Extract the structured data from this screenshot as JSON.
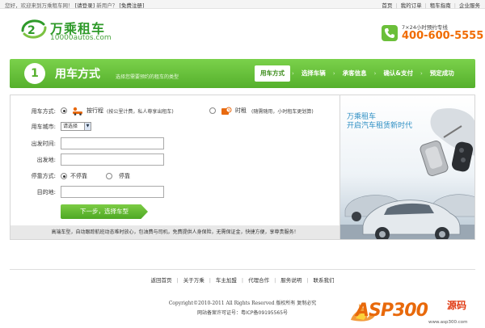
{
  "topbar": {
    "welcome": "您好，欢迎来到万乘租车网！",
    "login": "[请登录]",
    "new_user": "新用户？",
    "register": "[免费注册]",
    "links": [
      "首页",
      "我的订单",
      "租车指南",
      "企业服务"
    ]
  },
  "header": {
    "logo_cn": "万乘租车",
    "logo_en": "10000autos.com",
    "hotline_label": "7×24小时预约专线",
    "hotline_number": "400-600-5555"
  },
  "stepbar": {
    "number": "1",
    "title": "用车方式",
    "subtitle": "选择您需要预约的租车的类型",
    "steps": [
      "用车方式",
      "选择车辆",
      "承客信息",
      "确认&支付",
      "预定成功"
    ],
    "active_index": 0
  },
  "form": {
    "mode_label": "用车方式:",
    "mode_options": [
      {
        "label": "按行程",
        "hint": "(按公里计费，私人尊享出租车)",
        "selected": true
      },
      {
        "label": "时租",
        "hint": "(随需随用，小时租车更划算)",
        "selected": false
      }
    ],
    "city_label": "用车城市:",
    "city_value": "请选择",
    "depart_time_label": "出发时间:",
    "depart_place_label": "出发地:",
    "stop_label": "停靠方式:",
    "stop_options": [
      {
        "label": "不停靠",
        "selected": true
      },
      {
        "label": "停靠",
        "selected": false
      }
    ],
    "destination_label": "目的地:",
    "next_button": "下一步，选择车型",
    "notice": "高端车型，自动跟踪航班动态难时放心，包油费与司机，免费提供人身保险，无需保证金，快捷方便，享尊贵服务！"
  },
  "ad": {
    "brand": "万乘租车",
    "slogan": "开启汽车租赁新时代"
  },
  "footer": {
    "links": [
      "返回首页",
      "关于万乘",
      "车主加盟",
      "代理合作",
      "服务说明",
      "联系我们"
    ],
    "copyright": "Copyright©2010-2011 All Rights Reserved 版权所有 复制必究",
    "icp": "网站备案许可证号：粤ICP备09195565号"
  },
  "watermark": {
    "brand": "ASP300",
    "brand_cn": "源码",
    "url": "www.asp300.com"
  },
  "colors": {
    "brand_green": "#55b02c",
    "hotline_orange": "#f06b00",
    "ad_blue": "#2e8fc4"
  }
}
